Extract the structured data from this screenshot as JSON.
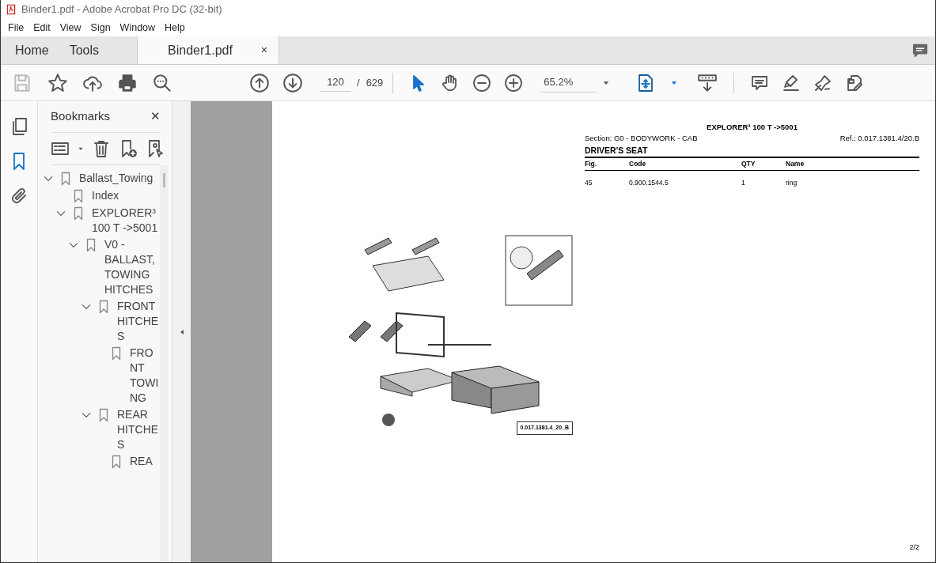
{
  "window": {
    "title": "Binder1.pdf - Adobe Acrobat Pro DC (32-bit)"
  },
  "menu": [
    "File",
    "Edit",
    "View",
    "Sign",
    "Window",
    "Help"
  ],
  "tabs": [
    {
      "label": "Home",
      "selected": false
    },
    {
      "label": "Tools",
      "selected": false
    },
    {
      "label": "Binder1.pdf",
      "selected": true,
      "close": "×"
    }
  ],
  "toolbar": {
    "page_current": "120",
    "page_separator": "/",
    "page_total": "629",
    "zoom": "65.2%"
  },
  "side_rail": [
    {
      "kind": "pages",
      "selected": false
    },
    {
      "kind": "bookmarks",
      "selected": true
    },
    {
      "kind": "attachments",
      "selected": false
    }
  ],
  "bookmarks": {
    "title": "Bookmarks",
    "close": "✕",
    "items": [
      {
        "label": "Ballast_Towing",
        "expanded": true,
        "children": [
          {
            "label": "Index"
          },
          {
            "label": "EXPLORER³ 100 T ->5001",
            "expanded": true,
            "children": [
              {
                "label": "V0 - BALLAST, TOWING HITCHES",
                "expanded": true,
                "children": [
                  {
                    "label": "FRONT HITCHES",
                    "expanded": true,
                    "children": [
                      {
                        "label": "FRONT TOWING"
                      }
                    ]
                  },
                  {
                    "label": "REAR HITCHES",
                    "expanded": true,
                    "children": [
                      {
                        "label": "REA"
                      }
                    ]
                  }
                ]
              }
            ]
          }
        ]
      }
    ]
  },
  "document": {
    "title": "EXPLORER³ 100 T ->5001",
    "section": "Section: G0 - BODYWORK - CAB",
    "ref": "Ref.: 0.017.1381.4/20.B",
    "heading": "DRIVER'S SEAT",
    "table": {
      "columns": [
        "Fig.",
        "Code",
        "QTY",
        "Name"
      ],
      "rows": [
        [
          "45",
          "0.900.1544.5",
          "1",
          "ring"
        ]
      ]
    },
    "diagram": {
      "kind": "picture",
      "label": "0.017.1381.4_20_B"
    },
    "page_number": "2/2"
  }
}
